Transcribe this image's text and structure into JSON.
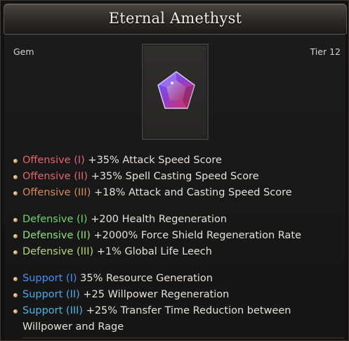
{
  "item": {
    "name": "Eternal Amethyst",
    "type": "Gem",
    "tier": "Tier 12",
    "icon": "amethyst-gem-icon"
  },
  "groups": [
    {
      "color": "#e0666b",
      "lines": [
        {
          "label": "Offensive (I)",
          "text": "+35% Attack Speed Score"
        },
        {
          "label": "Offensive (II)",
          "text": "+35% Spell Casting Speed Score"
        },
        {
          "label": "Offensive (III)",
          "text": "+18% Attack and Casting Speed Score"
        }
      ]
    },
    {
      "color": "#6fd36c",
      "lines": [
        {
          "label": "Defensive (I)",
          "text": "+200 Health Regeneration"
        },
        {
          "label": "Defensive (II)",
          "text": "+2000% Force Shield Regeneration Rate"
        },
        {
          "label": "Defensive (III)",
          "text": "+1% Global Life Leech"
        }
      ]
    },
    {
      "color": "#4c8cf0",
      "lines": [
        {
          "label": "Support (I)",
          "text": "35% Resource Generation"
        },
        {
          "label": "Support (II)",
          "text": "+25 Willpower Regeneration"
        },
        {
          "label": "Support (III)",
          "text": "+25% Transfer Time Reduction between Willpower and Rage"
        }
      ]
    }
  ],
  "colors": {
    "offensive_i": "#e0666b",
    "offensive_ii": "#e0666b",
    "offensive_iii": "#d88c55",
    "defensive_i": "#6fd36c",
    "defensive_ii": "#8fe07a",
    "defensive_iii": "#b6d870",
    "support_i": "#4c8cf0",
    "support_ii": "#4aa8e8",
    "support_iii": "#4bb6e4"
  }
}
